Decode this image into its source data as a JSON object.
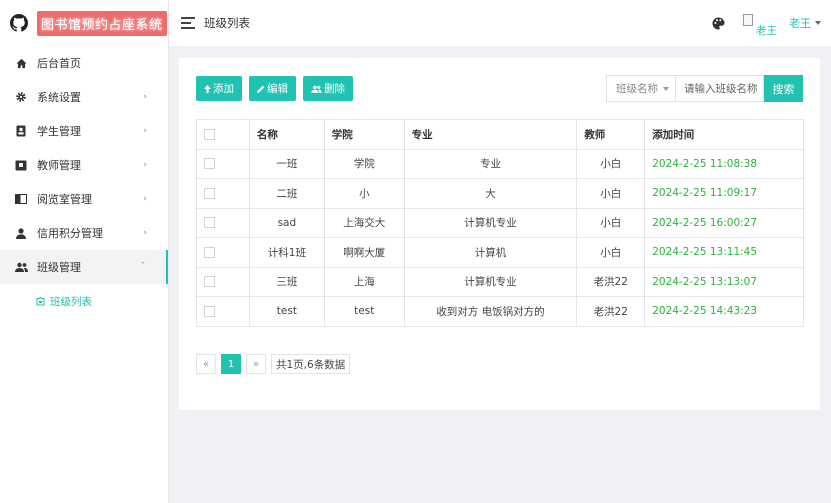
{
  "app": {
    "title": "图书馆预约占座系统"
  },
  "sidebar": {
    "items": [
      {
        "label": "后台首页",
        "icon": "home-icon"
      },
      {
        "label": "系统设置",
        "icon": "gear-icon"
      },
      {
        "label": "学生管理",
        "icon": "id-card-icon"
      },
      {
        "label": "教师管理",
        "icon": "teacher-board-icon"
      },
      {
        "label": "阅览室管理",
        "icon": "book-icon"
      },
      {
        "label": "信用积分管理",
        "icon": "user-icon"
      },
      {
        "label": "班级管理",
        "icon": "users-icon"
      }
    ],
    "submenu": [
      {
        "label": "班级列表",
        "icon": "class-list-icon"
      }
    ]
  },
  "header": {
    "page_title": "班级列表",
    "avatar_alt": "老王",
    "user_name": "老王"
  },
  "toolbar": {
    "add_label": "添加",
    "edit_label": "编辑",
    "delete_label": "删除"
  },
  "search": {
    "field_label": "班级名称",
    "placeholder": "请输入班级名称",
    "button_label": "搜索"
  },
  "table": {
    "headers": [
      "名称",
      "学院",
      "专业",
      "教师",
      "添加时间"
    ],
    "rows": [
      [
        "一班",
        "学院",
        "专业",
        "小白",
        "2024-2-25 11:08:38"
      ],
      [
        "二班",
        "小",
        "大",
        "小白",
        "2024-2-25 11:09:17"
      ],
      [
        "sad",
        "上海交大",
        "计算机专业",
        "小白",
        "2024-2-25 16:00:27"
      ],
      [
        "计科1班",
        "啊啊大厦",
        "计算机",
        "小白",
        "2024-2-25 13:11:45"
      ],
      [
        "三班",
        "上海",
        "计算机专业",
        "老洪22",
        "2024-2-25 13:13:07"
      ],
      [
        "test",
        "test",
        "收到对方 电饭锅对方的",
        "老洪22",
        "2024-2-25 14:43:23"
      ]
    ]
  },
  "pager": {
    "prev": "«",
    "current": "1",
    "next": "»",
    "info": "共1页,6条数据"
  },
  "colors": {
    "accent": "#20c3b2",
    "time_text": "#2ab43a",
    "brand_bg": "#ef6b6b"
  }
}
